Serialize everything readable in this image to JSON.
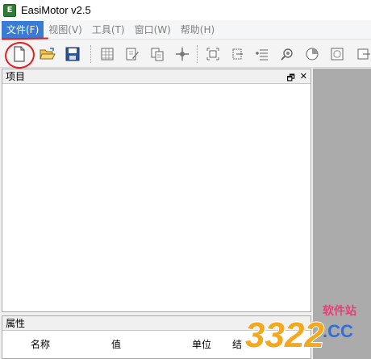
{
  "window": {
    "title": "EasiMotor v2.5",
    "app_icon_letter": "E"
  },
  "menu": [
    {
      "label": "文件(F)",
      "active": true
    },
    {
      "label": "视图(V)",
      "active": false
    },
    {
      "label": "工具(T)",
      "active": false
    },
    {
      "label": "窗口(W)",
      "active": false
    },
    {
      "label": "帮助(H)",
      "active": false
    }
  ],
  "toolbar": {
    "buttons": [
      "new-file-icon",
      "open-folder-icon",
      "save-icon",
      "grid-table-icon",
      "edit-doc-icon",
      "copy-doc-icon",
      "crosshair-icon",
      "node-add-icon",
      "shape-edit-icon",
      "list-add-icon",
      "search-ring-icon",
      "pie-chart-icon",
      "frame-icon",
      "export-icon"
    ]
  },
  "project_panel": {
    "title": "项目",
    "restore_glyph": "🗗",
    "close_glyph": "✕"
  },
  "property_panel": {
    "title": "属性",
    "columns": [
      "名称",
      "值",
      "单位",
      "结"
    ]
  },
  "watermark": {
    "digits": "3322",
    "top_text": "软件站",
    "domain": ".CC"
  },
  "colors": {
    "menu_active_bg": "#3a7bd5",
    "annotation_red": "#e02020",
    "right_pane_gray": "#ababab"
  }
}
